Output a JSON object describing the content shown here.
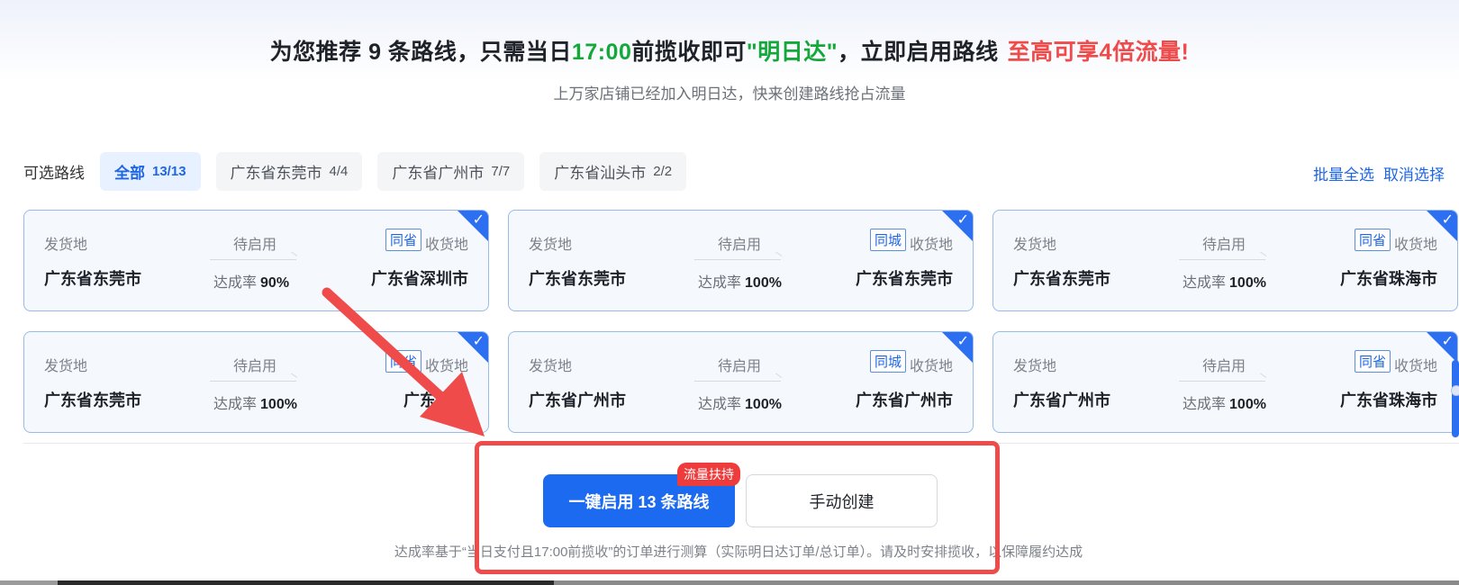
{
  "header": {
    "text1": "为您推荐 9 条路线，只需当日",
    "time": "17:00",
    "text2": "前揽收即可",
    "highlight": "\"明日达\"",
    "text3": "，立即启用路线",
    "promo": "至高可享4倍流量!",
    "subtitle": "上万家店铺已经加入明日达，快来创建路线抢占流量"
  },
  "filters": {
    "label": "可选路线",
    "chips": [
      {
        "name": "全部",
        "count": "13/13",
        "active": true
      },
      {
        "name": "广东省东莞市",
        "count": "4/4",
        "active": false
      },
      {
        "name": "广东省广州市",
        "count": "7/7",
        "active": false
      },
      {
        "name": "广东省汕头市",
        "count": "2/2",
        "active": false
      }
    ],
    "select_all": "批量全选",
    "deselect": "取消选择"
  },
  "card_labels": {
    "from": "发货地",
    "status": "待启用",
    "to": "收货地",
    "rate": "达成率"
  },
  "routes": [
    {
      "from": "广东省东莞市",
      "to": "广东省深圳市",
      "tag": "同省",
      "rate": "90%",
      "checked": true
    },
    {
      "from": "广东省东莞市",
      "to": "广东省东莞市",
      "tag": "同城",
      "rate": "100%",
      "checked": true
    },
    {
      "from": "广东省东莞市",
      "to": "广东省珠海市",
      "tag": "同省",
      "rate": "100%",
      "checked": true
    },
    {
      "from": "广东省东莞市",
      "to": "广东省汕",
      "tag": "同省",
      "rate": "100%",
      "checked": true
    },
    {
      "from": "广东省广州市",
      "to": "广东省广州市",
      "tag": "同城",
      "rate": "100%",
      "checked": true
    },
    {
      "from": "广东省广州市",
      "to": "广东省珠海市",
      "tag": "同省",
      "rate": "100%",
      "checked": true
    }
  ],
  "actions": {
    "primary": "一键启用 13 条路线",
    "badge": "流量扶持",
    "secondary": "手动创建"
  },
  "footnote": "达成率基于“当日支付且17:00前揽收”的订单进行测算（实际明日达订单/总订单）。请及时安排揽收，以保障履约达成",
  "colors": {
    "primary": "#1b6af0",
    "green": "#14a83b",
    "promo": "#f04b4b",
    "annotation": "#ef4b4b"
  }
}
